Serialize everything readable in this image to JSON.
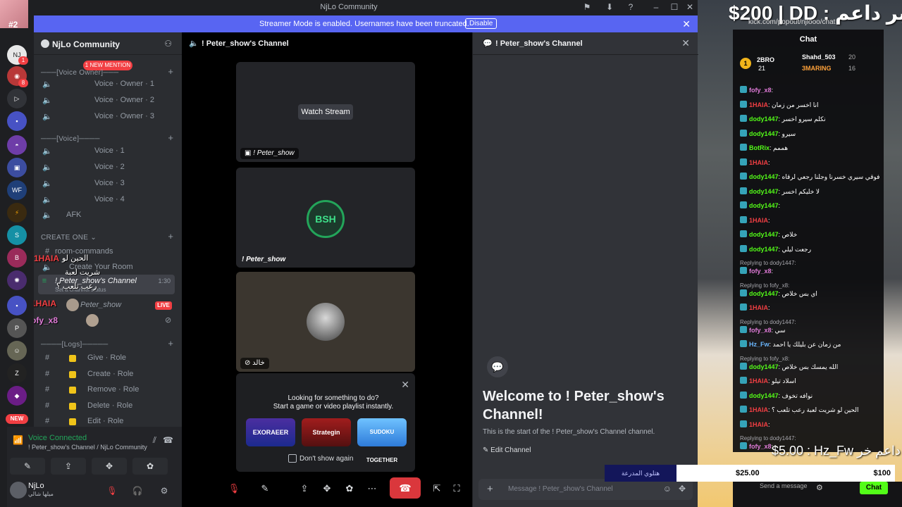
{
  "window": {
    "title": "NjLo Community"
  },
  "banner": {
    "message": "Streamer Mode is enabled. Usernames have been truncated.",
    "disable_label": "Disable"
  },
  "me_badge": "#2",
  "rail_new": "NEW",
  "server": {
    "name": "NjLo Community",
    "mention_pill": "1 NEW MENTION",
    "categories": {
      "voice_owner": "[Voice Owner]",
      "voice": "[Voice]",
      "create_one": "CREATE ONE",
      "logs": "[Logs]"
    },
    "channels": {
      "owner1": "Voice · Owner · 1",
      "owner2": "Voice · Owner · 2",
      "owner3": "Voice · Owner · 3",
      "voice1": "Voice · 1",
      "voice2": "Voice · 2",
      "voice3": "Voice · 3",
      "voice4": "Voice · 4",
      "afk": "AFK",
      "room_commands": "room-commands",
      "create_room": "Create Your Room",
      "peter": "! Peter_show's Channel",
      "peter_time": "1:30",
      "peter_status": "Set a channel status",
      "give_role": "Give · Role",
      "create_role": "Create · Role",
      "remove_role": "Remove · Role",
      "delete_role": "Delete · Role",
      "edit_role": "Edit · Role"
    },
    "members": {
      "m1_overlay": "1HAIA",
      "m1_name": "Peter_show",
      "m1_live": "LIVE",
      "m2_overlay": "fofy_x8"
    },
    "overlay_texts": {
      "a1": "1HAIA",
      "a2": "الحين لو",
      "a3": "شريت لعبة",
      "a4": "رعب تلعب ؟"
    }
  },
  "voice_panel": {
    "status": "Voice Connected",
    "sub": "! Peter_show's Channel / NjLo Community"
  },
  "user": {
    "name": "NjLo",
    "sub": "ميلها شالي"
  },
  "stage": {
    "title": "! Peter_show's Channel",
    "watch_label": "Watch Stream",
    "tile1_name": "! Peter_show",
    "tile2_name": "! Peter_show",
    "tile2_logo": "BSH",
    "tile3_name": "خالد",
    "activity": {
      "line1": "Looking for something to do?",
      "line2": "Start a game or video playlist instantly.",
      "games": [
        "EXORAEER",
        "Strategin",
        "SUDOKU TOGETHER"
      ],
      "dont_show": "Don't show again"
    }
  },
  "chat_panel": {
    "title": "! Peter_show's Channel",
    "welcome_title": "Welcome to ! Peter_show's Channel!",
    "welcome_sub": "This is the start of the ! Peter_show's Channel channel.",
    "edit_label": "Edit Channel",
    "input_placeholder": "Message ! Peter_show's Channel"
  },
  "stream_overlay": {
    "title": "$200 | DD : كبر داعم",
    "url": "kick.com/popout/njlooo/chat"
  },
  "kick": {
    "title": "Chat",
    "leaders": [
      {
        "rank": "1",
        "name": "2BRO",
        "value": "21"
      },
      {
        "rank": "",
        "name": "Shahd_503",
        "value": "20"
      },
      {
        "rank": "",
        "name": "3MARING",
        "value": "16"
      }
    ],
    "messages": [
      {
        "user": "fofy_x8",
        "text": "",
        "reply": ""
      },
      {
        "user": "1HAIA",
        "text": "انا اخسر من زمان",
        "reply": ""
      },
      {
        "user": "dody1447",
        "text": "نكلم سيرو اخسر",
        "reply": ""
      },
      {
        "user": "dody1447",
        "text": "سيرو",
        "reply": ""
      },
      {
        "user": "BotRix",
        "text": "هممم",
        "reply": ""
      },
      {
        "user": "1HAIA",
        "text": "",
        "reply": ""
      },
      {
        "user": "dody1447",
        "text": "فوقي سيري خسرنا وجلنا رجعي لرقاه",
        "reply": ""
      },
      {
        "user": "dody1447",
        "text": "لا خليكم اخسر",
        "reply": ""
      },
      {
        "user": "dody1447",
        "text": "",
        "reply": ""
      },
      {
        "user": "1HAIA",
        "text": "",
        "reply": ""
      },
      {
        "user": "dody1447",
        "text": "خلاص",
        "reply": ""
      },
      {
        "user": "dody1447",
        "text": "رجعت ليلي",
        "reply": ""
      },
      {
        "user": "fofy_x8",
        "text": "",
        "reply": "Replying to dody1447:"
      },
      {
        "user": "dody1447",
        "text": "اي بس خلاص",
        "reply": "Replying to fofy_x8:"
      },
      {
        "user": "1HAIA",
        "text": "",
        "reply": ""
      },
      {
        "user": "fofy_x8",
        "text": "سي",
        "reply": "Replying to dody1447:"
      },
      {
        "user": "Hz_Fw",
        "text": "من زمان عن بليلك يا احمد",
        "reply": ""
      },
      {
        "user": "dody1447",
        "text": "الله يمسك بس خلاص",
        "reply": "Replying to fofy_x8:"
      },
      {
        "user": "1HAIA",
        "text": "اسلاد تيلو",
        "reply": ""
      },
      {
        "user": "dody1447",
        "text": "نوافه تخوف",
        "reply": ""
      },
      {
        "user": "1HAIA",
        "text": "الحين لو شريت لعبة رعب تلعب ؟",
        "reply": ""
      },
      {
        "user": "1HAIA",
        "text": "",
        "reply": ""
      },
      {
        "user": "fofy_x8",
        "text": "",
        "reply": "Replying to dody1447:"
      }
    ],
    "tip_overlay": "$5.00 : Hz_Fw",
    "tip_overlay_ar": "داعم خر",
    "tip_left": "$25.00",
    "tip_right": "$100",
    "blue_box": "هتلوي المدرعة",
    "send_placeholder": "Send a message",
    "chat_button": "Chat"
  },
  "colors": {
    "accent": "#5865f2",
    "green": "#23a55a",
    "red": "#f23f43",
    "kick_green": "#53fc18"
  }
}
